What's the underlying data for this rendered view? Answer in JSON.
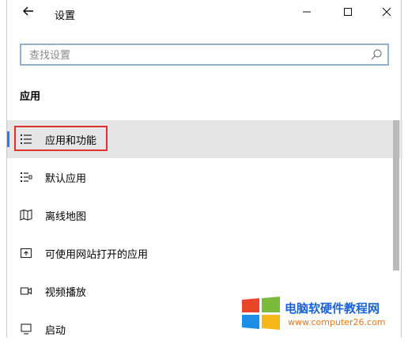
{
  "window": {
    "title": "设置"
  },
  "search": {
    "placeholder": "查找设置"
  },
  "section": {
    "title": "应用"
  },
  "items": [
    {
      "label": "应用和功能",
      "icon": "apps-features-icon",
      "selected": true
    },
    {
      "label": "默认应用",
      "icon": "default-apps-icon",
      "selected": false
    },
    {
      "label": "离线地图",
      "icon": "offline-maps-icon",
      "selected": false
    },
    {
      "label": "可使用网站打开的应用",
      "icon": "apps-for-websites-icon",
      "selected": false
    },
    {
      "label": "视频播放",
      "icon": "video-playback-icon",
      "selected": false
    },
    {
      "label": "启动",
      "icon": "startup-icon",
      "selected": false
    }
  ],
  "watermark": {
    "title": "电脑软硬件教程网",
    "url": "www.computer26.com"
  },
  "colors": {
    "accent": "#2f7fd8",
    "highlight": "#e0322d",
    "search_border": "#8fb3cc"
  }
}
